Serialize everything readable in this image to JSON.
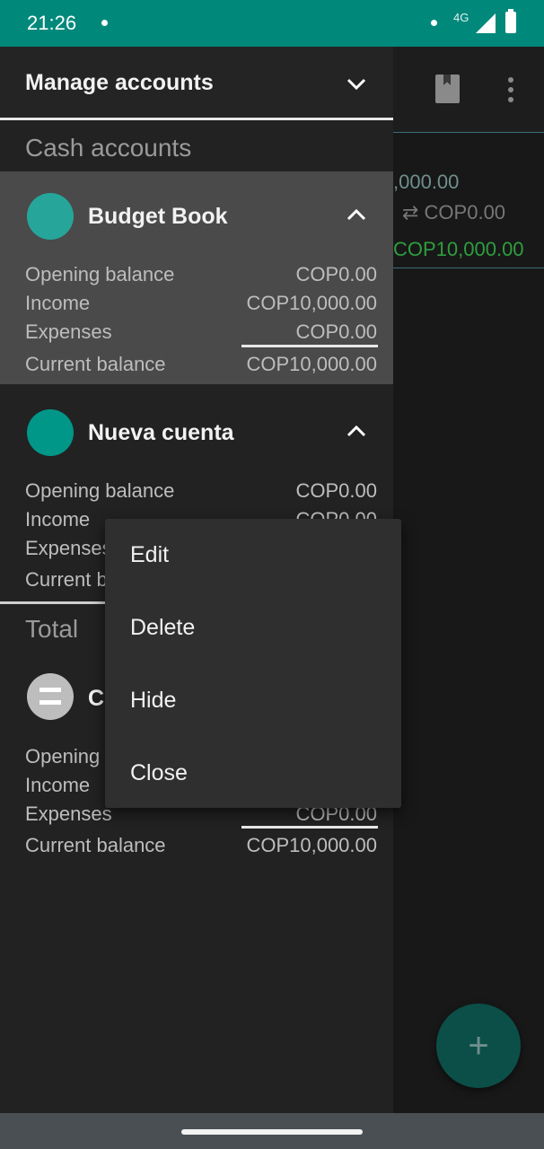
{
  "status_bar": {
    "time": "21:26",
    "network": "4G"
  },
  "drawer": {
    "title": "Manage accounts",
    "section_cash": "Cash accounts",
    "section_total": "Total",
    "accounts": [
      {
        "name": "Budget Book",
        "color": "#26a69a",
        "rows": [
          {
            "label": "Opening balance",
            "value": "COP0.00"
          },
          {
            "label": "Income",
            "value": "COP10,000.00"
          },
          {
            "label": "Expenses",
            "value": "COP0.00"
          },
          {
            "label": "Current balance",
            "value": "COP10,000.00"
          }
        ]
      },
      {
        "name": "Nueva cuenta",
        "color": "#009688",
        "rows": [
          {
            "label": "Opening balance",
            "value": "COP0.00"
          },
          {
            "label": "Income",
            "value": "COP0.00"
          },
          {
            "label": "Expenses",
            "value": ""
          },
          {
            "label": "Current b",
            "value": ""
          }
        ]
      }
    ],
    "total": {
      "name": "C",
      "rows": [
        {
          "label": "Opening",
          "value": ""
        },
        {
          "label": "Income",
          "value": ""
        },
        {
          "label": "Expenses",
          "value": "COP0.00"
        },
        {
          "label": "Current balance",
          "value": "COP10,000.00"
        }
      ]
    }
  },
  "background": {
    "text1": ",000.00",
    "text2": "⇄ COP0.00",
    "text3": "COP10,000.00",
    "fab_label": "+"
  },
  "popup_menu": {
    "items": [
      "Edit",
      "Delete",
      "Hide",
      "Close"
    ]
  }
}
